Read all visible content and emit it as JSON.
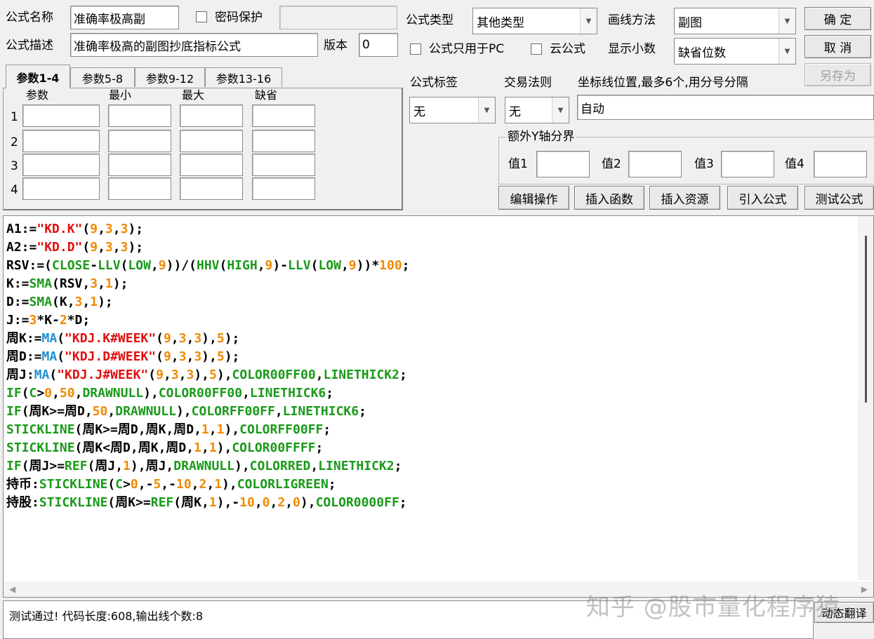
{
  "formula_name": {
    "label": "公式名称",
    "value": "准确率极高副"
  },
  "password": {
    "label": "密码保护",
    "value": ""
  },
  "formula_desc": {
    "label": "公式描述",
    "value": "准确率极高的副图抄底指标公式"
  },
  "version": {
    "label": "版本",
    "value": "0"
  },
  "formula_type": {
    "label": "公式类型",
    "value": "其他类型"
  },
  "draw_method": {
    "label": "画线方法",
    "value": "副图"
  },
  "pc_only": {
    "label": "公式只用于PC",
    "checked": false
  },
  "cloud": {
    "label": "云公式",
    "checked": false
  },
  "decimals": {
    "label": "显示小数",
    "value": "缺省位数"
  },
  "buttons": {
    "ok": "确  定",
    "cancel": "取  消",
    "save_as": "另存为",
    "edit_ops": "编辑操作",
    "insert_func": "插入函数",
    "insert_res": "插入资源",
    "import_formula": "引入公式",
    "test_formula": "测试公式"
  },
  "tabs": [
    "参数1-4",
    "参数5-8",
    "参数9-12",
    "参数13-16"
  ],
  "param_table": {
    "headers": [
      "参数",
      "最小",
      "最大",
      "缺省"
    ],
    "rows": [
      "1",
      "2",
      "3",
      "4"
    ]
  },
  "formula_tag": {
    "label": "公式标签",
    "value": "无"
  },
  "trade_rule": {
    "label": "交易法则",
    "value": "无"
  },
  "coord_lines": {
    "label": "坐标线位置,最多6个,用分号分隔",
    "value": "自动"
  },
  "extra_y": {
    "title": "额外Y轴分界",
    "labels": [
      "值1",
      "值2",
      "值3",
      "值4"
    ]
  },
  "code_colors": {
    "default": "#000000",
    "string": "#e01010",
    "number": "#ef8a00",
    "function": "#1a9a1a",
    "func_ma": "#1e90d0"
  },
  "code_lines": [
    [
      [
        "A1:=",
        "d"
      ],
      [
        "\"KD.K\"",
        "s"
      ],
      [
        "(",
        "d"
      ],
      [
        "9",
        "n"
      ],
      [
        ",",
        "d"
      ],
      [
        "3",
        "n"
      ],
      [
        ",",
        "d"
      ],
      [
        "3",
        "n"
      ],
      [
        ");",
        "d"
      ]
    ],
    [
      [
        "A2:=",
        "d"
      ],
      [
        "\"KD.D\"",
        "s"
      ],
      [
        "(",
        "d"
      ],
      [
        "9",
        "n"
      ],
      [
        ",",
        "d"
      ],
      [
        "3",
        "n"
      ],
      [
        ",",
        "d"
      ],
      [
        "3",
        "n"
      ],
      [
        ");",
        "d"
      ]
    ],
    [
      [
        "RSV:=(",
        "d"
      ],
      [
        "CLOSE",
        "f"
      ],
      [
        "-",
        "d"
      ],
      [
        "LLV",
        "f"
      ],
      [
        "(",
        "d"
      ],
      [
        "LOW",
        "f"
      ],
      [
        ",",
        "d"
      ],
      [
        "9",
        "n"
      ],
      [
        "))/(",
        "d"
      ],
      [
        "HHV",
        "f"
      ],
      [
        "(",
        "d"
      ],
      [
        "HIGH",
        "f"
      ],
      [
        ",",
        "d"
      ],
      [
        "9",
        "n"
      ],
      [
        ")-",
        "d"
      ],
      [
        "LLV",
        "f"
      ],
      [
        "(",
        "d"
      ],
      [
        "LOW",
        "f"
      ],
      [
        ",",
        "d"
      ],
      [
        "9",
        "n"
      ],
      [
        "))*",
        "d"
      ],
      [
        "100",
        "n"
      ],
      [
        ";",
        "d"
      ]
    ],
    [
      [
        "K:=",
        "d"
      ],
      [
        "SMA",
        "f"
      ],
      [
        "(RSV,",
        "d"
      ],
      [
        "3",
        "n"
      ],
      [
        ",",
        "d"
      ],
      [
        "1",
        "n"
      ],
      [
        ");",
        "d"
      ]
    ],
    [
      [
        "D:=",
        "d"
      ],
      [
        "SMA",
        "f"
      ],
      [
        "(K,",
        "d"
      ],
      [
        "3",
        "n"
      ],
      [
        ",",
        "d"
      ],
      [
        "1",
        "n"
      ],
      [
        ");",
        "d"
      ]
    ],
    [
      [
        "J:=",
        "d"
      ],
      [
        "3",
        "n"
      ],
      [
        "*K-",
        "d"
      ],
      [
        "2",
        "n"
      ],
      [
        "*D;",
        "d"
      ]
    ],
    [
      [
        "周K:=",
        "d"
      ],
      [
        "MA",
        "m"
      ],
      [
        "(",
        "d"
      ],
      [
        "\"KDJ.K#WEEK\"",
        "s"
      ],
      [
        "(",
        "d"
      ],
      [
        "9",
        "n"
      ],
      [
        ",",
        "d"
      ],
      [
        "3",
        "n"
      ],
      [
        ",",
        "d"
      ],
      [
        "3",
        "n"
      ],
      [
        "),",
        "d"
      ],
      [
        "5",
        "n"
      ],
      [
        ");",
        "d"
      ]
    ],
    [
      [
        "周D:=",
        "d"
      ],
      [
        "MA",
        "m"
      ],
      [
        "(",
        "d"
      ],
      [
        "\"KDJ.D#WEEK\"",
        "s"
      ],
      [
        "(",
        "d"
      ],
      [
        "9",
        "n"
      ],
      [
        ",",
        "d"
      ],
      [
        "3",
        "n"
      ],
      [
        ",",
        "d"
      ],
      [
        "3",
        "n"
      ],
      [
        "),",
        "d"
      ],
      [
        "5",
        "n"
      ],
      [
        ");",
        "d"
      ]
    ],
    [
      [
        "周J:",
        "d"
      ],
      [
        "MA",
        "m"
      ],
      [
        "(",
        "d"
      ],
      [
        "\"KDJ.J#WEEK\"",
        "s"
      ],
      [
        "(",
        "d"
      ],
      [
        "9",
        "n"
      ],
      [
        ",",
        "d"
      ],
      [
        "3",
        "n"
      ],
      [
        ",",
        "d"
      ],
      [
        "3",
        "n"
      ],
      [
        "),",
        "d"
      ],
      [
        "5",
        "n"
      ],
      [
        "),",
        "d"
      ],
      [
        "COLOR00FF00",
        "f"
      ],
      [
        ",",
        "d"
      ],
      [
        "LINETHICK2",
        "f"
      ],
      [
        ";",
        "d"
      ]
    ],
    [
      [
        "IF",
        "f"
      ],
      [
        "(",
        "d"
      ],
      [
        "C",
        "f"
      ],
      [
        ">",
        "d"
      ],
      [
        "0",
        "n"
      ],
      [
        ",",
        "d"
      ],
      [
        "50",
        "n"
      ],
      [
        ",",
        "d"
      ],
      [
        "DRAWNULL",
        "f"
      ],
      [
        "),",
        "d"
      ],
      [
        "COLOR00FF00",
        "f"
      ],
      [
        ",",
        "d"
      ],
      [
        "LINETHICK6",
        "f"
      ],
      [
        ";",
        "d"
      ]
    ],
    [
      [
        "IF",
        "f"
      ],
      [
        "(周K>=周D,",
        "d"
      ],
      [
        "50",
        "n"
      ],
      [
        ",",
        "d"
      ],
      [
        "DRAWNULL",
        "f"
      ],
      [
        "),",
        "d"
      ],
      [
        "COLORFF00FF",
        "f"
      ],
      [
        ",",
        "d"
      ],
      [
        "LINETHICK6",
        "f"
      ],
      [
        ";",
        "d"
      ]
    ],
    [
      [
        "STICKLINE",
        "f"
      ],
      [
        "(周K>=周D,周K,周D,",
        "d"
      ],
      [
        "1",
        "n"
      ],
      [
        ",",
        "d"
      ],
      [
        "1",
        "n"
      ],
      [
        "),",
        "d"
      ],
      [
        "COLORFF00FF",
        "f"
      ],
      [
        ";",
        "d"
      ]
    ],
    [
      [
        "STICKLINE",
        "f"
      ],
      [
        "(周K<周D,周K,周D,",
        "d"
      ],
      [
        "1",
        "n"
      ],
      [
        ",",
        "d"
      ],
      [
        "1",
        "n"
      ],
      [
        "),",
        "d"
      ],
      [
        "COLOR00FFFF",
        "f"
      ],
      [
        ";",
        "d"
      ]
    ],
    [
      [
        "IF",
        "f"
      ],
      [
        "(周J>=",
        "d"
      ],
      [
        "REF",
        "f"
      ],
      [
        "(周J,",
        "d"
      ],
      [
        "1",
        "n"
      ],
      [
        "),周J,",
        "d"
      ],
      [
        "DRAWNULL",
        "f"
      ],
      [
        "),",
        "d"
      ],
      [
        "COLORRED",
        "f"
      ],
      [
        ",",
        "d"
      ],
      [
        "LINETHICK2",
        "f"
      ],
      [
        ";",
        "d"
      ]
    ],
    [
      [
        "持币:",
        "d"
      ],
      [
        "STICKLINE",
        "f"
      ],
      [
        "(",
        "d"
      ],
      [
        "C",
        "f"
      ],
      [
        ">",
        "d"
      ],
      [
        "0",
        "n"
      ],
      [
        ",-",
        "d"
      ],
      [
        "5",
        "n"
      ],
      [
        ",-",
        "d"
      ],
      [
        "10",
        "n"
      ],
      [
        ",",
        "d"
      ],
      [
        "2",
        "n"
      ],
      [
        ",",
        "d"
      ],
      [
        "1",
        "n"
      ],
      [
        "),",
        "d"
      ],
      [
        "COLORLIGREEN",
        "f"
      ],
      [
        ";",
        "d"
      ]
    ],
    [
      [
        "持股:",
        "d"
      ],
      [
        "STICKLINE",
        "f"
      ],
      [
        "(周K>=",
        "d"
      ],
      [
        "REF",
        "f"
      ],
      [
        "(周K,",
        "d"
      ],
      [
        "1",
        "n"
      ],
      [
        "),-",
        "d"
      ],
      [
        "10",
        "n"
      ],
      [
        ",",
        "d"
      ],
      [
        "0",
        "n"
      ],
      [
        ",",
        "d"
      ],
      [
        "2",
        "n"
      ],
      [
        ",",
        "d"
      ],
      [
        "0",
        "n"
      ],
      [
        "),",
        "d"
      ],
      [
        "COLOR0000FF",
        "f"
      ],
      [
        ";",
        "d"
      ]
    ]
  ],
  "status_text": "测试通过! 代码长度:608,输出线个数:8",
  "translate_button": "动态翻译",
  "watermark": "知乎 @股市量化程序猿"
}
